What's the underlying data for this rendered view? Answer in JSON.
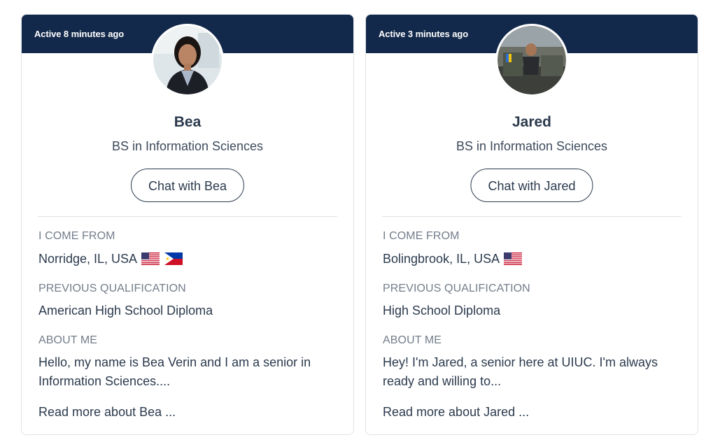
{
  "cards": [
    {
      "active": "Active 8 minutes ago",
      "name": "Bea",
      "degree": "BS in Information Sciences",
      "chat_label": "Chat with Bea",
      "from_label": "I COME FROM",
      "from_value": "Norridge, IL, USA",
      "flags": [
        "us-flag-icon",
        "philippines-flag-icon"
      ],
      "qual_label": "PREVIOUS QUALIFICATION",
      "qual_value": "American High School Diploma",
      "about_label": "ABOUT ME",
      "about_value": "Hello, my name is Bea Verin and I am a senior in Information Sciences....",
      "read_more": "Read more about Bea ..."
    },
    {
      "active": "Active 3 minutes ago",
      "name": "Jared",
      "degree": "BS in Information Sciences",
      "chat_label": "Chat with Jared",
      "from_label": "I COME FROM",
      "from_value": "Bolingbrook, IL, USA",
      "flags": [
        "us-flag-icon"
      ],
      "qual_label": "PREVIOUS QUALIFICATION",
      "qual_value": "High School Diploma",
      "about_label": "ABOUT ME",
      "about_value": "Hey! I'm Jared, a senior here at UIUC. I'm always ready and willing to...",
      "read_more": "Read more about Jared ..."
    }
  ],
  "colors": {
    "header_bg": "#13294b",
    "text": "#2b3a4d",
    "muted": "#737d8a",
    "border": "#dfe3e8"
  }
}
